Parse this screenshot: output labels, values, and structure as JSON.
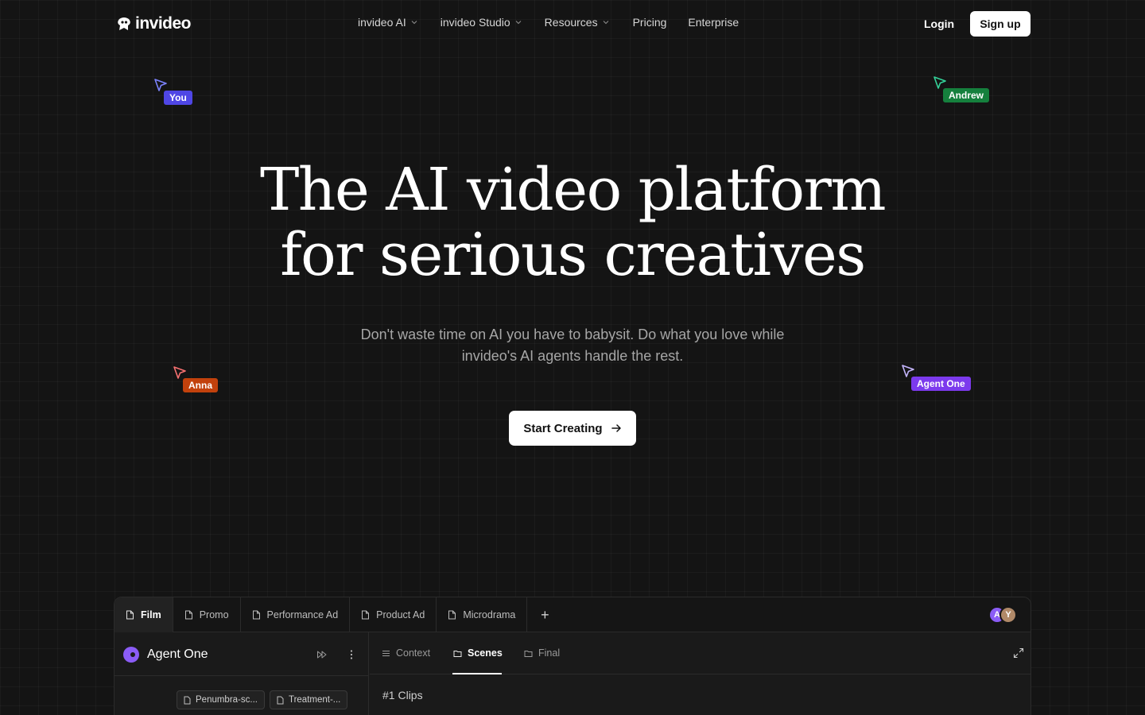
{
  "nav": {
    "brand": "invideo",
    "links": [
      {
        "label": "invideo AI",
        "dropdown": true
      },
      {
        "label": "invideo Studio",
        "dropdown": true
      },
      {
        "label": "Resources",
        "dropdown": true
      },
      {
        "label": "Pricing",
        "dropdown": false
      },
      {
        "label": "Enterprise",
        "dropdown": false
      }
    ],
    "login": "Login",
    "signup": "Sign up"
  },
  "cursors": [
    {
      "label": "You",
      "color": "#4f46e5"
    },
    {
      "label": "Andrew",
      "color": "#15803d"
    },
    {
      "label": "Anna",
      "color": "#c2410c"
    },
    {
      "label": "Agent One",
      "color": "#7c3aed"
    }
  ],
  "hero": {
    "title_line1": "The AI video platform",
    "title_line2": "for serious creatives",
    "subtitle": "Don't waste time on AI you have to babysit. Do what you love while invideo's AI agents handle the rest.",
    "cta": "Start Creating"
  },
  "app": {
    "tabs": [
      {
        "label": "Film",
        "active": true
      },
      {
        "label": "Promo",
        "active": false
      },
      {
        "label": "Performance Ad",
        "active": false
      },
      {
        "label": "Product Ad",
        "active": false
      },
      {
        "label": "Microdrama",
        "active": false
      }
    ],
    "add_tab": "+",
    "avatars": [
      {
        "initial": "A",
        "color": "#8b5cf6"
      },
      {
        "initial": "Y",
        "color": "#b08968"
      }
    ],
    "agent": {
      "name": "Agent One",
      "files": [
        "Penumbra-sc...",
        "Treatment-..."
      ]
    },
    "subtabs": [
      {
        "label": "Context",
        "icon": "list-icon",
        "active": false
      },
      {
        "label": "Scenes",
        "icon": "folder-icon",
        "active": true
      },
      {
        "label": "Final",
        "icon": "folder-icon",
        "active": false
      }
    ],
    "section_number": "#1",
    "section_title": "Clips"
  }
}
